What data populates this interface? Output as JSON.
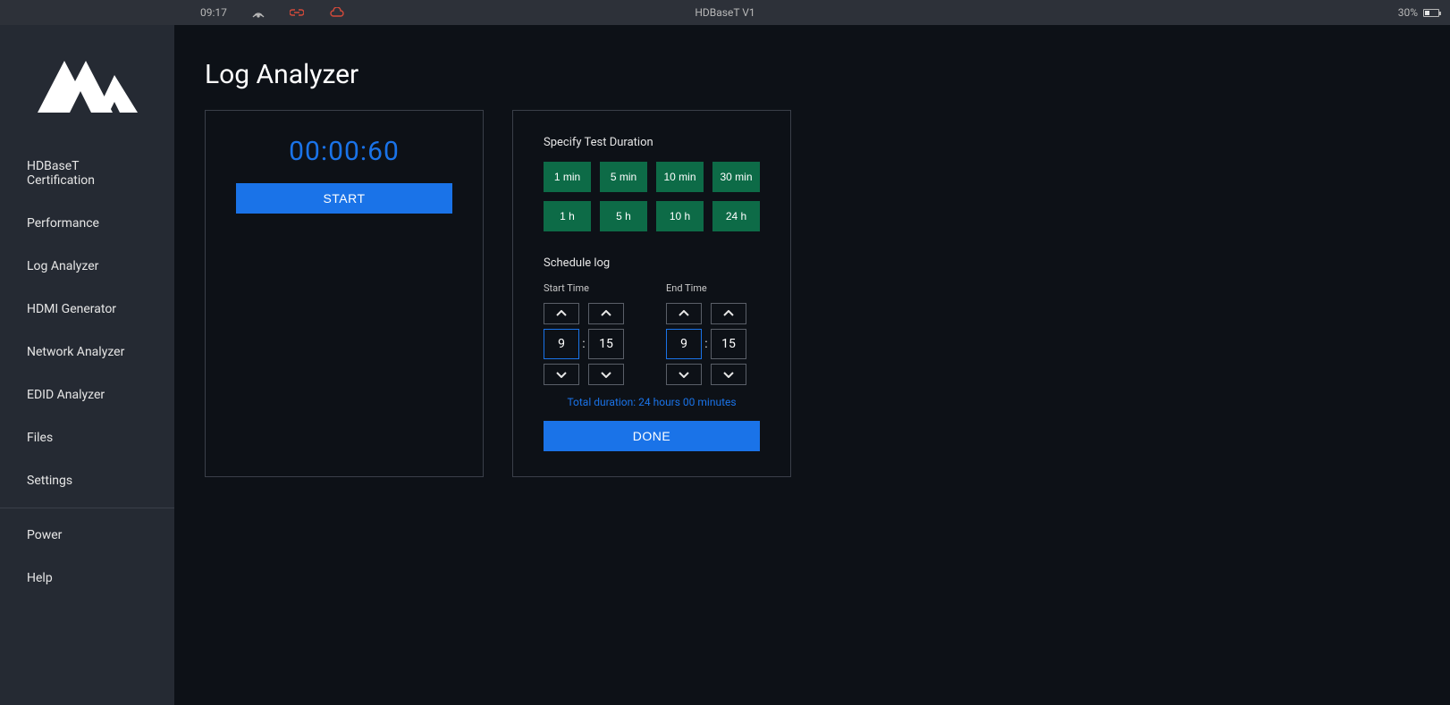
{
  "topbar": {
    "time": "09:17",
    "title": "HDBaseT V1",
    "battery_pct": "30%"
  },
  "sidebar": {
    "items": [
      {
        "label": "HDBaseT Certification"
      },
      {
        "label": "Performance"
      },
      {
        "label": "Log Analyzer"
      },
      {
        "label": "HDMI Generator"
      },
      {
        "label": "Network Analyzer"
      },
      {
        "label": "EDID Analyzer"
      },
      {
        "label": "Files"
      },
      {
        "label": "Settings"
      }
    ],
    "footer": [
      {
        "label": "Power"
      },
      {
        "label": "Help"
      }
    ]
  },
  "page": {
    "title": "Log Analyzer",
    "timer": {
      "value": "00:00:60",
      "start_label": "START"
    },
    "duration": {
      "section_label": "Specify Test Duration",
      "options": [
        "1 min",
        "5 min",
        "10 min",
        "30 min",
        "1 h",
        "5 h",
        "10 h",
        "24 h"
      ],
      "schedule_label": "Schedule log",
      "start_label": "Start Time",
      "end_label": "End Time",
      "start": {
        "hour": "9",
        "minute": "15"
      },
      "end": {
        "hour": "9",
        "minute": "15"
      },
      "total_label": "Total duration: 24 hours 00 minutes",
      "done_label": "DONE"
    }
  }
}
